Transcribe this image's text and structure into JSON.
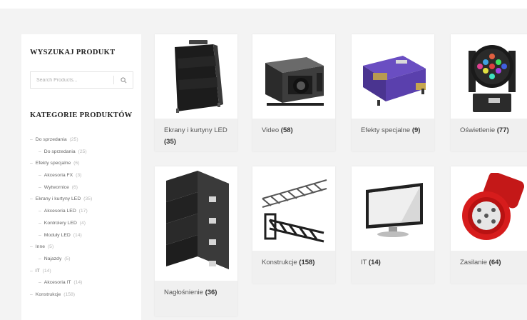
{
  "sidebar": {
    "search_title": "WYSZUKAJ PRODUKT",
    "search_placeholder": "Search Products...",
    "categories_title": "KATEGORIE PRODUKTÓW",
    "categories": [
      {
        "label": "Do sprzedania",
        "count": "(25)",
        "level": 0
      },
      {
        "label": "Do sprzedania",
        "count": "(25)",
        "level": 1
      },
      {
        "label": "Efekty specjalne",
        "count": "(6)",
        "level": 0
      },
      {
        "label": "Akcesoria FX",
        "count": "(3)",
        "level": 1
      },
      {
        "label": "Wytwornice",
        "count": "(6)",
        "level": 1
      },
      {
        "label": "Ekrany i kurtyny LED",
        "count": "(35)",
        "level": 0
      },
      {
        "label": "Akcesoria LED",
        "count": "(17)",
        "level": 1
      },
      {
        "label": "Kontrolery LED",
        "count": "(4)",
        "level": 1
      },
      {
        "label": "Moduły LED",
        "count": "(14)",
        "level": 1
      },
      {
        "label": "Inne",
        "count": "(5)",
        "level": 0
      },
      {
        "label": "Najazdy",
        "count": "(5)",
        "level": 1
      },
      {
        "label": "IT",
        "count": "(14)",
        "level": 0
      },
      {
        "label": "Akcesoria IT",
        "count": "(14)",
        "level": 1
      },
      {
        "label": "Konstrukcje",
        "count": "(158)",
        "level": 0
      }
    ]
  },
  "products": [
    {
      "name": "Ekrany i kurtyny LED",
      "count": "(35)",
      "icon": "led-panel-icon"
    },
    {
      "name": "Video",
      "count": "(58)",
      "icon": "projector-icon"
    },
    {
      "name": "Efekty specjalne",
      "count": "(9)",
      "icon": "fog-machine-icon"
    },
    {
      "name": "Oświetlenie",
      "count": "(77)",
      "icon": "moving-head-light-icon"
    },
    {
      "name": "Nagłośnienie",
      "count": "(36)",
      "icon": "speaker-array-icon"
    },
    {
      "name": "Konstrukcje",
      "count": "(158)",
      "icon": "truss-icon"
    },
    {
      "name": "IT",
      "count": "(14)",
      "icon": "monitor-icon"
    },
    {
      "name": "Zasilanie",
      "count": "(64)",
      "icon": "power-plug-icon"
    }
  ]
}
